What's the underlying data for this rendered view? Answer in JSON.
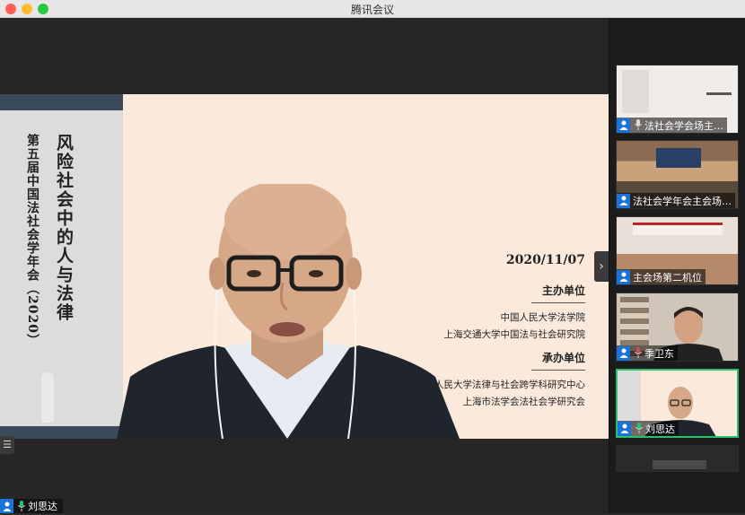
{
  "window": {
    "title": "腾讯会议"
  },
  "slide": {
    "subtitle_vertical": "第五届中国法社会学年会（2020）",
    "title_vertical": "风险社会中的人与法律",
    "date": "2020/11/07",
    "host_heading": "主办单位",
    "hosts": [
      "中国人民大学法学院",
      "上海交通大学中国法与社会研究院"
    ],
    "organizer_heading": "承办单位",
    "organizers": [
      "中国人民大学法律与社会跨学科研究中心",
      "上海市法学会法社会学研究会"
    ]
  },
  "speaker": {
    "name": "刘思达"
  },
  "participants": [
    {
      "name": "法社会学会场主…",
      "mic": true,
      "active": false
    },
    {
      "name": "法社会学年会主会场…",
      "mic": false,
      "active": false
    },
    {
      "name": "主会场第二机位",
      "mic": false,
      "active": false
    },
    {
      "name": "季卫东",
      "mic": true,
      "active": false
    },
    {
      "name": "刘思达",
      "mic": true,
      "active": true
    }
  ],
  "colors": {
    "accent": "#1a73d9",
    "active_border": "#2bc16a",
    "slide_bg": "#fbe9db"
  }
}
